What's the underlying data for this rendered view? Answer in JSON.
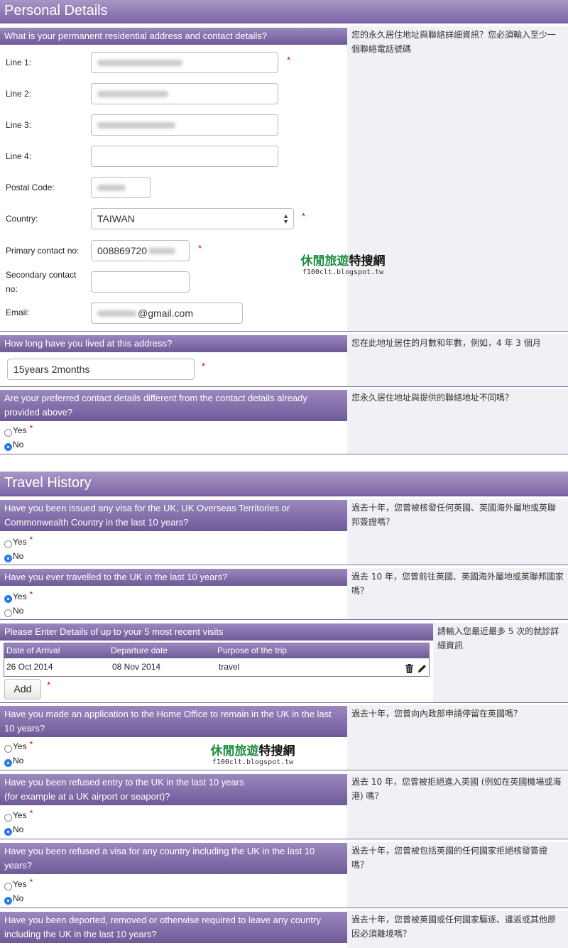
{
  "personal": {
    "title": "Personal Details",
    "address_q": "What is your permanent residential address and contact details?",
    "address_note": "您的永久居住地址與聯絡詳細資訊？您必須輸入至少一個聯絡電話號碼",
    "line1_label": "Line 1:",
    "line2_label": "Line 2:",
    "line3_label": "Line 3:",
    "line4_label": "Line 4:",
    "postal_label": "Postal Code:",
    "country_label": "Country:",
    "country_value": "TAIWAN",
    "primary_label": "Primary contact no:",
    "primary_value": "008869720",
    "secondary_label": "Secondary contact no:",
    "email_label": "Email:",
    "email_value": "@gmail.com",
    "howlong_q": "How long have you lived at this address?",
    "howlong_note": "您在此地址居住的月數和年數，例如，4 年 3 個月",
    "howlong_value": "15years 2months",
    "preferred_q": "Are your preferred contact details different from the contact details already provided above?",
    "preferred_note": "您永久居住地址與提供的聯絡地址不同嗎？"
  },
  "travel": {
    "title": "Travel History",
    "q1": "Have you been issued any visa for the UK, UK Overseas Territories or Commonwealth Country in the last 10 years?",
    "q1_note": "過去十年，您曾被核發任何英國、英國海外屬地或英聯邦簽證嗎？",
    "q2": "Have you ever travelled to the UK in the last 10 years?",
    "q2_note": "過去 10 年，您曾前往英國、英國海外屬地或英聯邦國家嗎？",
    "visits_head": "Please Enter Details of up to your 5 most recent visits",
    "visits_note": "請輸入您最近最多 5 次的就診詳細資訊",
    "col_arrival": "Date of Arrival",
    "col_departure": "Departure date",
    "col_purpose": "Purpose of the trip",
    "row_arrival": "26 Oct 2014",
    "row_departure": "08 Nov 2014",
    "row_purpose": "travel",
    "add_label": "Add",
    "q3": "Have you made an application to the Home Office to remain in the UK in the last 10 years?",
    "q3_note": "過去十年，您曾向內政部申請停留在英國嗎？",
    "q4a": "Have you been refused entry to the UK in the last 10 years",
    "q4b": "(for example at a UK airport or seaport)?",
    "q4_note": "過去 10 年，您曾被拒絕進入英國 (例如在英國機場或海港) 嗎？",
    "q5": "Have you been refused a visa for any country including the UK in the last 10 years?",
    "q5_note": "過去十年，您曾被包括英國的任何國家拒絕核發簽證嗎？",
    "q6": "Have you been deported, removed or otherwise required to leave any country including the UK in the last 10 years?",
    "q6_note": "過去十年，您曾被英國或任何國家驅逐、遣返或其他原因必須離境嗎？"
  },
  "radio": {
    "yes": "Yes",
    "no": "No",
    "required": "*"
  },
  "watermark": {
    "text_a": "休閒",
    "text_b": "旅遊",
    "text_c": "特搜網",
    "url": "f100clt.blogspot.tw"
  }
}
